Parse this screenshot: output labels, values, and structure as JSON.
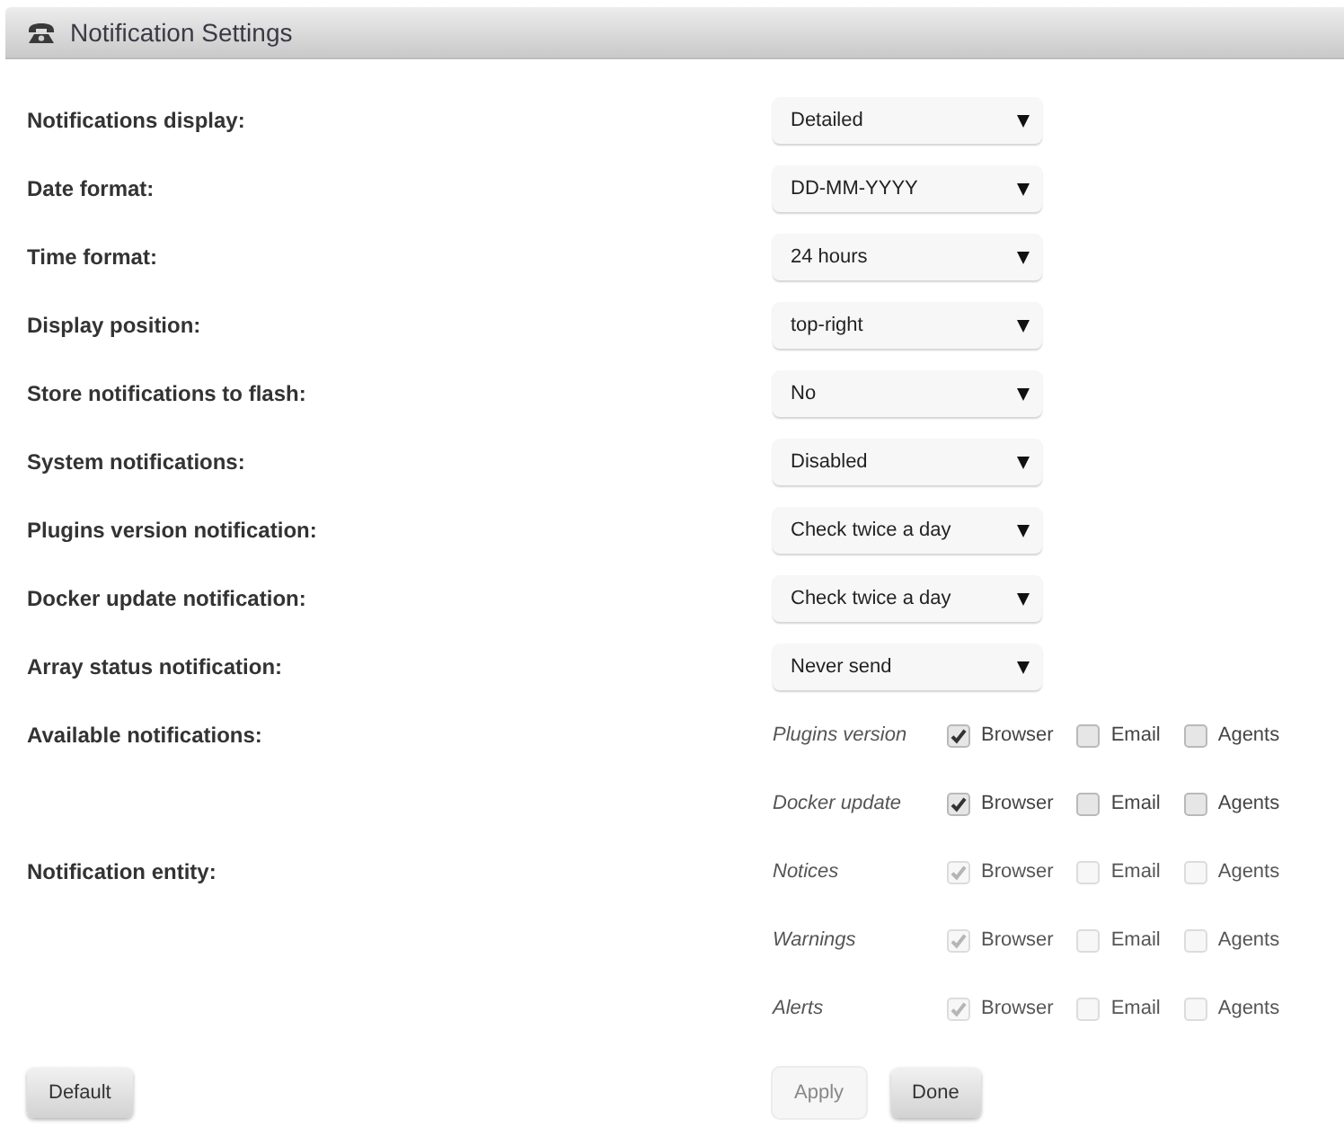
{
  "header": {
    "title": "Notification Settings"
  },
  "settings": [
    {
      "label": "Notifications display:",
      "value": "Detailed"
    },
    {
      "label": "Date format:",
      "value": "DD-MM-YYYY"
    },
    {
      "label": "Time format:",
      "value": "24 hours"
    },
    {
      "label": "Display position:",
      "value": "top-right"
    },
    {
      "label": "Store notifications to flash:",
      "value": "No"
    },
    {
      "label": "System notifications:",
      "value": "Disabled"
    },
    {
      "label": "Plugins version notification:",
      "value": "Check twice a day"
    },
    {
      "label": "Docker update notification:",
      "value": "Check twice a day"
    },
    {
      "label": "Array status notification:",
      "value": "Never send"
    }
  ],
  "groups": [
    {
      "label": "Available notifications:",
      "items": [
        {
          "name": "Plugins version",
          "options": [
            {
              "label": "Browser",
              "checked": true,
              "disabled": false
            },
            {
              "label": "Email",
              "checked": false,
              "disabled": false
            },
            {
              "label": "Agents",
              "checked": false,
              "disabled": false
            }
          ]
        },
        {
          "name": "Docker update",
          "options": [
            {
              "label": "Browser",
              "checked": true,
              "disabled": false
            },
            {
              "label": "Email",
              "checked": false,
              "disabled": false
            },
            {
              "label": "Agents",
              "checked": false,
              "disabled": false
            }
          ]
        }
      ]
    },
    {
      "label": "Notification entity:",
      "items": [
        {
          "name": "Notices",
          "options": [
            {
              "label": "Browser",
              "checked": true,
              "disabled": true
            },
            {
              "label": "Email",
              "checked": false,
              "disabled": true
            },
            {
              "label": "Agents",
              "checked": false,
              "disabled": true
            }
          ]
        },
        {
          "name": "Warnings",
          "options": [
            {
              "label": "Browser",
              "checked": true,
              "disabled": true
            },
            {
              "label": "Email",
              "checked": false,
              "disabled": true
            },
            {
              "label": "Agents",
              "checked": false,
              "disabled": true
            }
          ]
        },
        {
          "name": "Alerts",
          "options": [
            {
              "label": "Browser",
              "checked": true,
              "disabled": true
            },
            {
              "label": "Email",
              "checked": false,
              "disabled": true
            },
            {
              "label": "Agents",
              "checked": false,
              "disabled": true
            }
          ]
        }
      ]
    }
  ],
  "left_buttons": [
    {
      "label": "Default",
      "disabled": false
    }
  ],
  "right_buttons": [
    {
      "label": "Apply",
      "disabled": true
    },
    {
      "label": "Done",
      "disabled": false
    }
  ]
}
